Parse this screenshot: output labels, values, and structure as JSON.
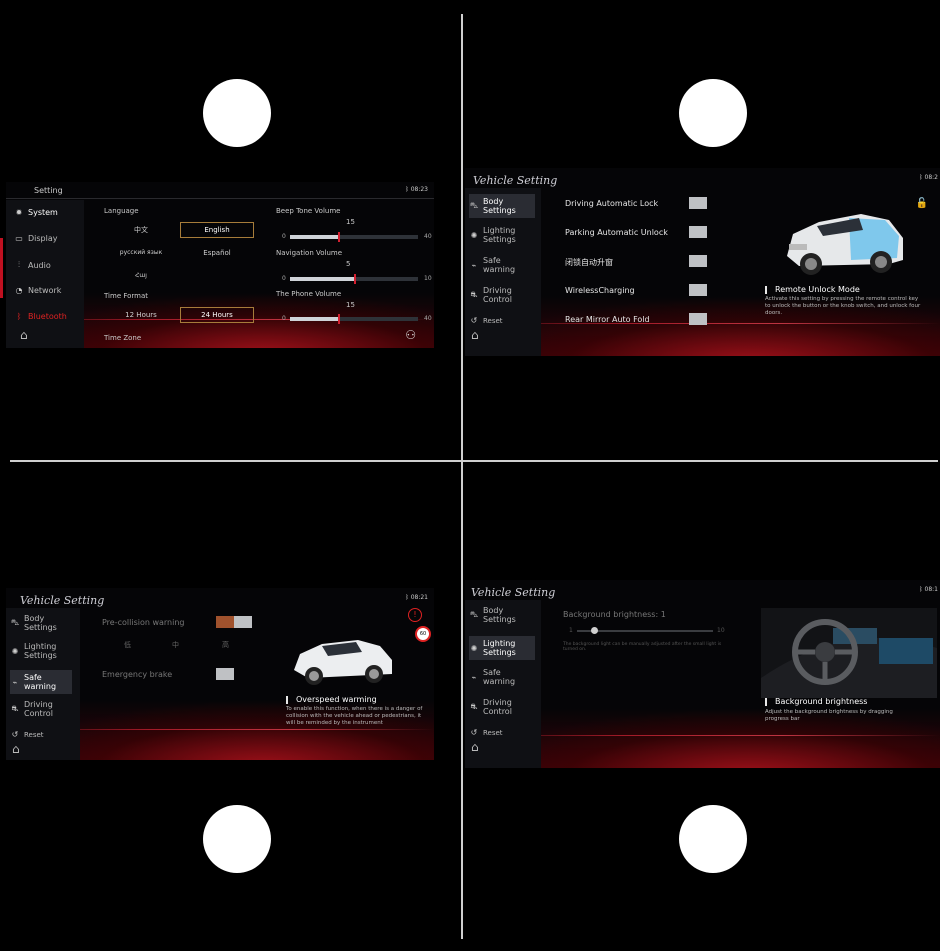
{
  "q1": {
    "header": "Setting",
    "time": "08:23",
    "sidebar": [
      {
        "label": "System",
        "icon": "gear-icon"
      },
      {
        "label": "Display",
        "icon": "monitor-icon"
      },
      {
        "label": "Audio",
        "icon": "equalizer-icon"
      },
      {
        "label": "Network",
        "icon": "network-icon"
      },
      {
        "label": "Bluetooth",
        "icon": "bluetooth-icon"
      }
    ],
    "language_label": "Language",
    "languages": [
      "中文",
      "English",
      "русский язык",
      "Español",
      "Հայ"
    ],
    "selected_language": "English",
    "time_format_label": "Time Format",
    "time_formats": [
      "12 Hours",
      "24 Hours"
    ],
    "selected_time_format": "24 Hours",
    "time_zone_label": "Time Zone",
    "sliders": [
      {
        "label": "Beep Tone Volume",
        "value": "15",
        "min": "0",
        "max": "40",
        "level": 0.375
      },
      {
        "label": "Navigation Volume",
        "value": "5",
        "min": "0",
        "max": "10",
        "level": 0.5
      },
      {
        "label": "The Phone Volume",
        "value": "15",
        "min": "0",
        "max": "40",
        "level": 0.375
      }
    ]
  },
  "q2": {
    "title": "Vehicle Setting",
    "time": "08:2",
    "sidebar": [
      "Body Settings",
      "Lighting Settings",
      "Safe warning",
      "Driving Control",
      "Reset"
    ],
    "rows": [
      "Driving Automatic Lock",
      "Parking Automatic Unlock",
      "闭锁自动升窗",
      "WirelessCharging",
      "Rear Mirror Auto Fold"
    ],
    "info_title": "Remote Unlock Mode",
    "info_desc": "Activate this setting by pressing the remote control key to unlock the button or the knob switch, and unlock four doors."
  },
  "q3": {
    "title": "Vehicle Setting",
    "time": "08:21",
    "sidebar": [
      "Body Settings",
      "Lighting Settings",
      "Safe warning",
      "Driving Control",
      "Reset"
    ],
    "rows": [
      "Pre-collision warning",
      "Emergency brake"
    ],
    "levels": [
      "低",
      "中",
      "高"
    ],
    "speed_sign": "60",
    "info_title": "Overspeed warming",
    "info_desc": "To enable this function, when there is a danger of collision with the vehicle ahead or pedestrians, it will be reminded by the instrument"
  },
  "q4": {
    "title": "Vehicle Setting",
    "time": "08:1",
    "sidebar": [
      "Body Settings",
      "Lighting Settings",
      "Safe warning",
      "Driving Control",
      "Reset"
    ],
    "brightness_label": "Background brightness: 1",
    "brightness_min": "1",
    "brightness_max": "10",
    "brightness_level": 0.1,
    "brightness_note": "The background light can be manually adjusted after the small light is turned on.",
    "info_title": "Background brightness",
    "info_desc": "Adjust the background brightness by dragging progress bar"
  }
}
